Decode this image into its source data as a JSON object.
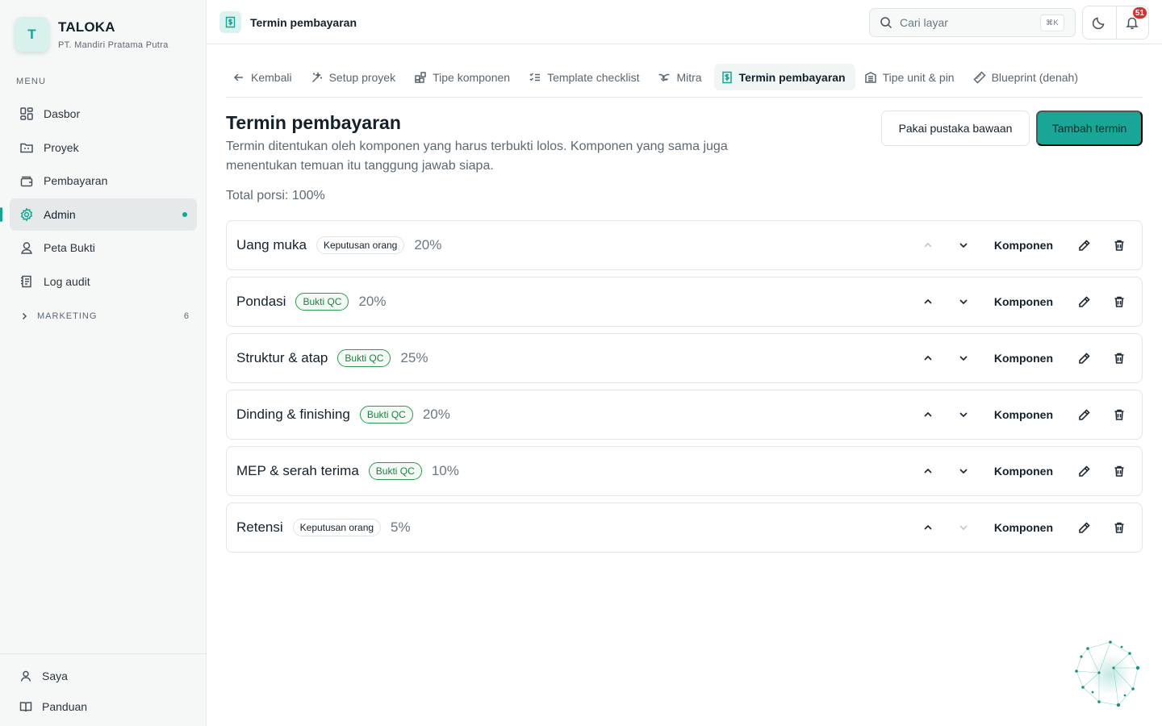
{
  "brand": {
    "logo_letter": "T",
    "name": "TALOKA",
    "company": "PT. Mandiri Pratama Putra"
  },
  "sidebar": {
    "menu_label": "MENU",
    "items": [
      {
        "label": "Dasbor",
        "icon": "dashboard-icon"
      },
      {
        "label": "Proyek",
        "icon": "folder-icon"
      },
      {
        "label": "Pembayaran",
        "icon": "wallet-icon"
      },
      {
        "label": "Admin",
        "icon": "gear-icon",
        "active": true
      },
      {
        "label": "Peta Bukti",
        "icon": "user-pin-icon"
      },
      {
        "label": "Log audit",
        "icon": "audit-log-icon"
      }
    ],
    "group": {
      "label": "MARKETING",
      "count": "6"
    },
    "bottom": [
      {
        "label": "Saya",
        "icon": "user-icon"
      },
      {
        "label": "Panduan",
        "icon": "book-icon"
      }
    ]
  },
  "header": {
    "title": "Termin pembayaran",
    "search_placeholder": "Cari layar",
    "search_shortcut": "⌘K",
    "notification_count": "51"
  },
  "tabs": [
    {
      "label": "Kembali",
      "icon": "arrow-left-icon"
    },
    {
      "label": "Setup proyek",
      "icon": "magic-wand-icon"
    },
    {
      "label": "Tipe komponen",
      "icon": "components-icon"
    },
    {
      "label": "Template checklist",
      "icon": "checklist-icon"
    },
    {
      "label": "Mitra",
      "icon": "handshake-icon"
    },
    {
      "label": "Termin pembayaran",
      "icon": "receipt-icon",
      "active": true
    },
    {
      "label": "Tipe unit & pin",
      "icon": "building-icon"
    },
    {
      "label": "Blueprint (denah)",
      "icon": "ruler-icon"
    }
  ],
  "page": {
    "title": "Termin pembayaran",
    "description": "Termin ditentukan oleh komponen yang harus terbukti lolos. Komponen yang sama juga menentukan temuan itu tanggung jawab siapa.",
    "secondary_button": "Pakai pustaka bawaan",
    "primary_button": "Tambah termin",
    "total_label": "Total porsi: 100%"
  },
  "terms": [
    {
      "name": "Uang muka",
      "badge": "Keputusan orang",
      "badge_type": "manual",
      "portion": "20%",
      "up_disabled": true,
      "down_disabled": false
    },
    {
      "name": "Pondasi",
      "badge": "Bukti QC",
      "badge_type": "qc",
      "portion": "20%",
      "up_disabled": false,
      "down_disabled": false
    },
    {
      "name": "Struktur & atap",
      "badge": "Bukti QC",
      "badge_type": "qc",
      "portion": "25%",
      "up_disabled": false,
      "down_disabled": false
    },
    {
      "name": "Dinding & finishing",
      "badge": "Bukti QC",
      "badge_type": "qc",
      "portion": "20%",
      "up_disabled": false,
      "down_disabled": false
    },
    {
      "name": "MEP & serah terima",
      "badge": "Bukti QC",
      "badge_type": "qc",
      "portion": "10%",
      "up_disabled": false,
      "down_disabled": false
    },
    {
      "name": "Retensi",
      "badge": "Keputusan orang",
      "badge_type": "manual",
      "portion": "5%",
      "up_disabled": false,
      "down_disabled": true
    }
  ],
  "term_action_label": "Komponen",
  "colors": {
    "accent": "#19a696",
    "qc_badge": "#2b9a4d",
    "notification": "#d0322d"
  }
}
